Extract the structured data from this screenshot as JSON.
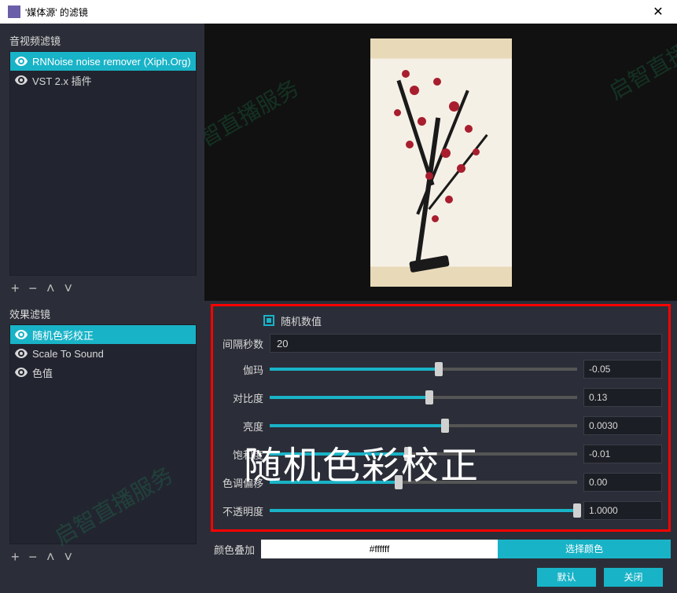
{
  "window": {
    "title": "'媒体源' 的滤镜"
  },
  "sections": {
    "av_label": "音视频滤镜",
    "fx_label": "效果滤镜"
  },
  "av_filters": [
    {
      "name": "RNNoise noise remover (Xiph.Org)",
      "selected": true
    },
    {
      "name": "VST 2.x 插件",
      "selected": false
    }
  ],
  "fx_filters": [
    {
      "name": "随机色彩校正",
      "selected": true
    },
    {
      "name": "Scale To Sound",
      "selected": false
    },
    {
      "name": "色值",
      "selected": false
    }
  ],
  "toolbar": {
    "add": "+",
    "remove": "−",
    "up": "˄",
    "down": "˅"
  },
  "props": {
    "random_check_label": "随机数值",
    "random_checked": true,
    "interval_label": "间隔秒数",
    "interval_value": "20",
    "sliders": [
      {
        "label": "伽玛",
        "value": "-0.05",
        "pct": 55
      },
      {
        "label": "对比度",
        "value": "0.13",
        "pct": 52
      },
      {
        "label": "亮度",
        "value": "0.0030",
        "pct": 57
      },
      {
        "label": "饱和度",
        "value": "-0.01",
        "pct": 45
      },
      {
        "label": "色调偏移",
        "value": "0.00",
        "pct": 42
      },
      {
        "label": "不透明度",
        "value": "1.0000",
        "pct": 100
      }
    ],
    "color_label": "颜色叠加",
    "color_hex": "#ffffff",
    "color_pick": "选择颜色"
  },
  "buttons": {
    "default": "默认",
    "close": "关闭"
  },
  "overlay": "随机色彩校正",
  "watermarks": [
    "启智直播服务",
    "启智直播",
    "启智直播服务"
  ]
}
